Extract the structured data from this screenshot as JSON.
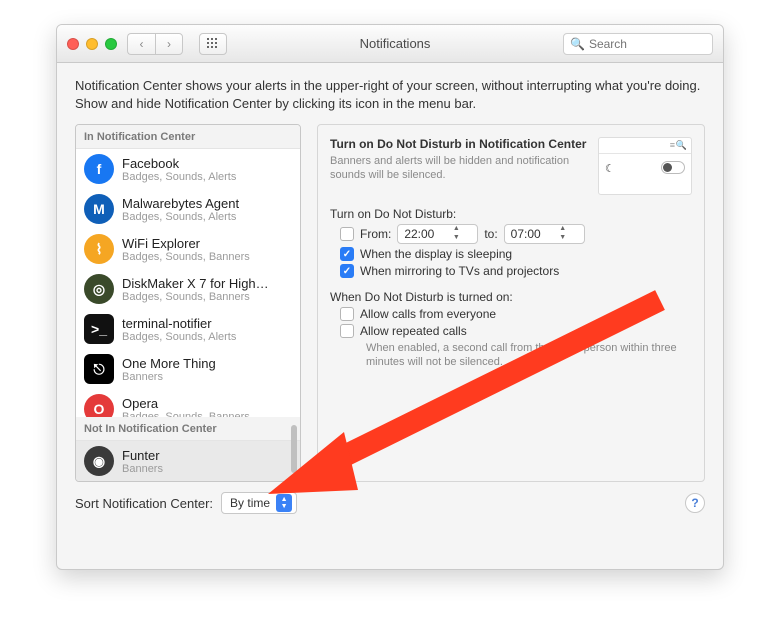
{
  "window": {
    "title": "Notifications",
    "search_placeholder": "Search"
  },
  "intro": "Notification Center shows your alerts in the upper-right of your screen, without interrupting what you're doing. Show and hide Notification Center by clicking its icon in the menu bar.",
  "sidebar": {
    "section_in": "In Notification Center",
    "section_not_in": "Not In Notification Center",
    "apps_in": [
      {
        "name": "Facebook",
        "sub": "Badges, Sounds, Alerts",
        "icon_bg": "#1877f2",
        "icon_char": "f",
        "icon_round": true
      },
      {
        "name": "Malwarebytes Agent",
        "sub": "Badges, Sounds, Alerts",
        "icon_bg": "#0f5fb8",
        "icon_char": "M",
        "icon_round": true
      },
      {
        "name": "WiFi Explorer",
        "sub": "Badges, Sounds, Banners",
        "icon_bg": "#f5a623",
        "icon_char": "⌇",
        "icon_round": true
      },
      {
        "name": "DiskMaker X 7 for High…",
        "sub": "Badges, Sounds, Banners",
        "icon_bg": "#3a4a2a",
        "icon_char": "◎",
        "icon_round": true
      },
      {
        "name": "terminal-notifier",
        "sub": "Badges, Sounds, Alerts",
        "icon_bg": "#111111",
        "icon_char": ">_",
        "icon_round": false
      },
      {
        "name": "One More Thing",
        "sub": "Banners",
        "icon_bg": "#000000",
        "icon_char": "⎋",
        "icon_round": false
      },
      {
        "name": "Opera",
        "sub": "Badges, Sounds, Banners",
        "icon_bg": "#e43a3a",
        "icon_char": "O",
        "icon_round": true
      }
    ],
    "apps_not_in": [
      {
        "name": "Funter",
        "sub": "Banners",
        "icon_bg": "#3a3a3a",
        "icon_char": "◉",
        "icon_round": true
      }
    ]
  },
  "dnd": {
    "title": "Turn on Do Not Disturb in Notification Center",
    "desc": "Banners and alerts will be hidden and notification sounds will be silenced.",
    "turn_on_label": "Turn on Do Not Disturb:",
    "from_label": "From:",
    "from_time": "22:00",
    "to_label": "to:",
    "to_time": "07:00",
    "when_sleep": "When the display is sleeping",
    "when_mirror": "When mirroring to TVs and projectors",
    "on_label": "When Do Not Disturb is turned on:",
    "allow_everyone": "Allow calls from everyone",
    "allow_repeated": "Allow repeated calls",
    "footnote": "When enabled, a second call from the same person within three minutes will not be silenced."
  },
  "bottom": {
    "sort_label": "Sort Notification Center:",
    "sort_value": "By time"
  }
}
